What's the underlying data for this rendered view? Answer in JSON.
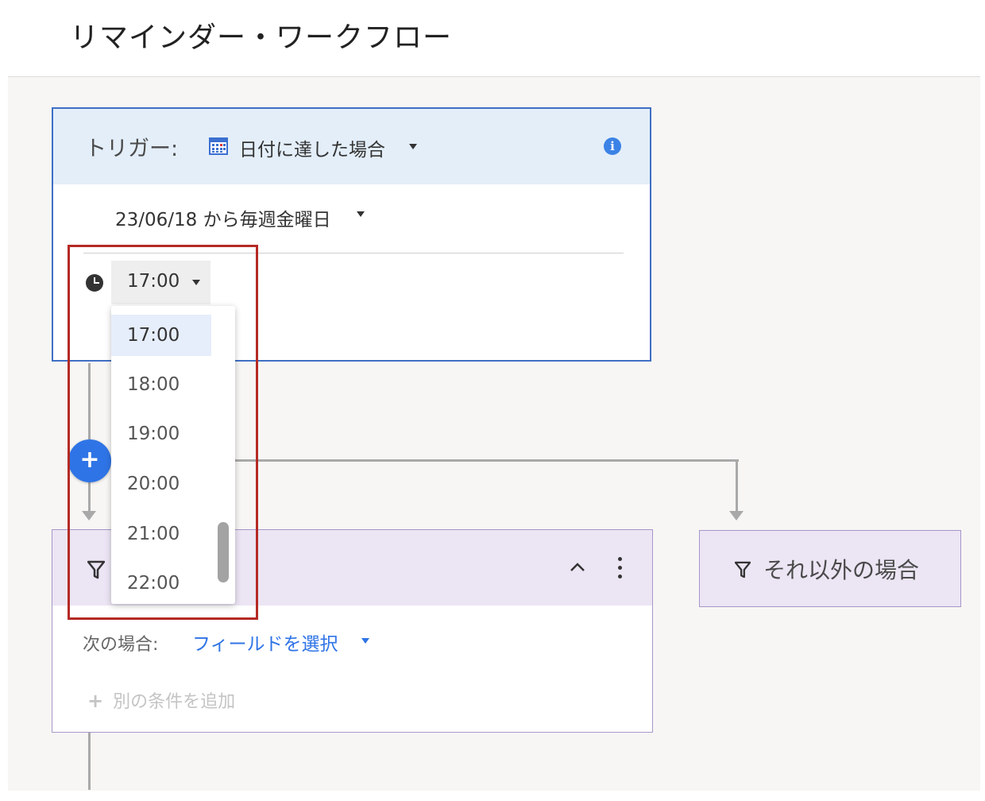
{
  "page": {
    "title": "リマインダー・ワークフロー"
  },
  "trigger": {
    "label": "トリガー:",
    "type": "日付に達した場合",
    "schedule": "23/06/18 から毎週金曜日",
    "time": "17:00"
  },
  "time_dropdown": {
    "options": [
      "17:00",
      "18:00",
      "19:00",
      "20:00",
      "21:00",
      "22:00"
    ],
    "selected": "17:00"
  },
  "condition": {
    "if_label": "次の場合:",
    "field_placeholder": "フィールドを選択",
    "add_condition_label": "別の条件を追加"
  },
  "else_branch": {
    "label": "それ以外の場合"
  },
  "colors": {
    "accent_blue": "#2f74e6",
    "trigger_header_bg": "#e3eef9",
    "condition_header_bg": "#ece5f4",
    "highlight_red": "#b42a25"
  },
  "icons": {
    "calendar": "calendar-icon",
    "info": "info-icon",
    "clock": "clock-icon",
    "add": "plus-icon",
    "filter": "filter-icon",
    "collapse": "chevron-up-icon",
    "menu": "kebab-menu-icon"
  }
}
